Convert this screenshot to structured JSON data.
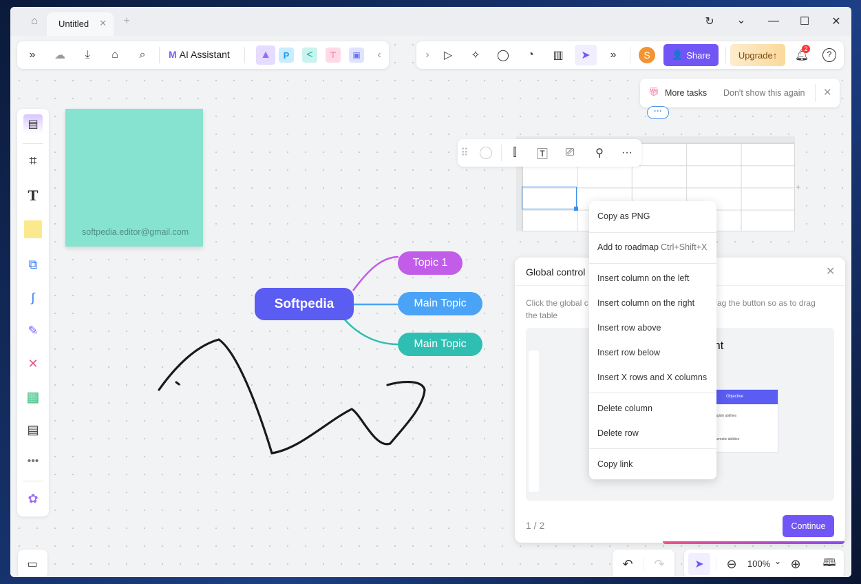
{
  "tabs": {
    "home_icon": "home-icon",
    "active_tab": "Untitled",
    "new_tab": "+"
  },
  "window_controls": {
    "refresh": "↻",
    "dropdown": "⌄",
    "minimize": "—",
    "maximize": "☐",
    "close": "✕"
  },
  "left_toolbar": {
    "ai_label": "AI Assistant"
  },
  "right_toolbar": {
    "avatar": "S",
    "share": "Share",
    "upgrade": "Upgrade",
    "notification_count": "2",
    "help": "?"
  },
  "tip": {
    "more_tasks": "More tasks",
    "dont_show": "Don't show this again"
  },
  "sticky_note": {
    "text": "softpedia.editor@gmail.com",
    "color": "#85e3cf"
  },
  "mindmap": {
    "root": "Softpedia",
    "topics": [
      "Topic 1",
      "Main Topic",
      "Main Topic"
    ],
    "colors": [
      "#c15de9",
      "#4aa3f6",
      "#2fbfb2"
    ],
    "root_color": "#5b5cf2"
  },
  "context_menu": {
    "items": [
      "Copy as PNG",
      "Add to roadmap",
      "Insert column on the left",
      "Insert column on the right",
      "Insert row above",
      "Insert row below",
      "Insert X rows and X columns",
      "Delete column",
      "Delete row",
      "Copy link"
    ],
    "shortcut": "Ctrl+Shift+X"
  },
  "guide": {
    "title": "Global control",
    "body_left": "Click the global c",
    "body_right": "rag the button so as to drag",
    "body_line2": "the table",
    "preview_title": "oint",
    "preview_header": "Objective",
    "preview_row1": "ove students' English abilities",
    "preview_row2": "e students' mathematic abilities",
    "pager": "1 / 2",
    "continue": "Continue"
  },
  "bottom": {
    "zoom": "100%"
  },
  "accent": "#7256f5"
}
